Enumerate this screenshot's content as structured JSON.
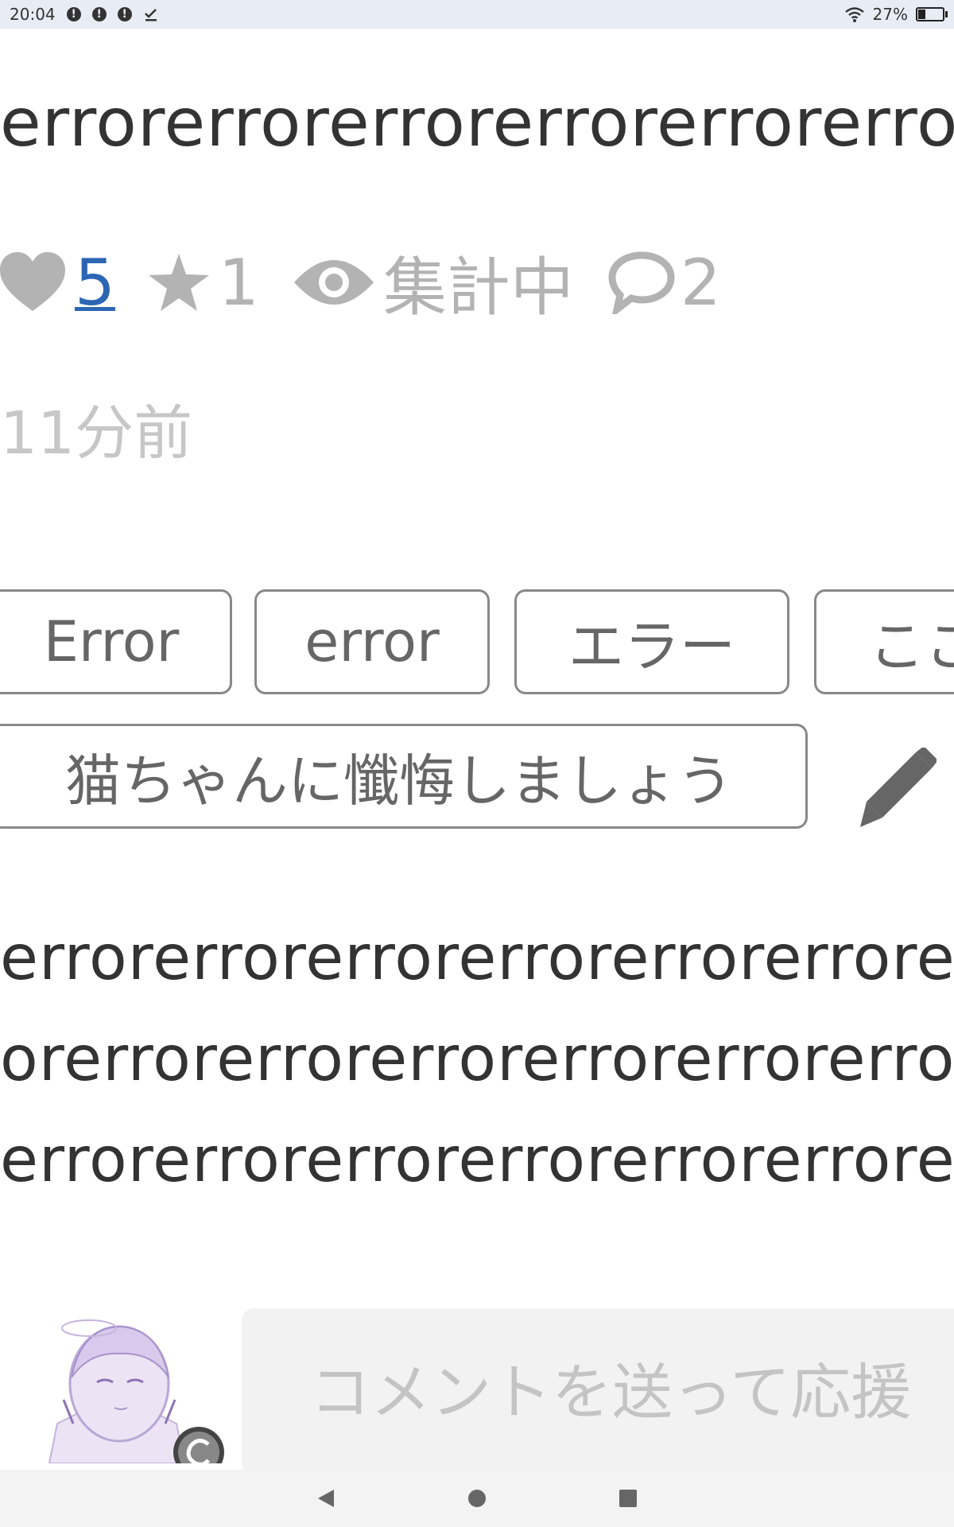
{
  "status_bar": {
    "time": "20:04",
    "notifications": [
      "!",
      "!",
      "!"
    ],
    "battery_text": "27%",
    "battery_level": 0.27
  },
  "post": {
    "title": "errorerrorerrorerrorerrorerror",
    "likes": "5",
    "bookmarks": "1",
    "views": "集計中",
    "comments": "2",
    "timestamp": "11分前",
    "tags": [
      "Error",
      "error",
      "エラー",
      "ここ",
      "猫ちゃんに懺悔しましょう"
    ],
    "body_lines": [
      "errorerrorerrorerrorerrorerrorerror",
      "orerrorerrorerrorerrorerrorerrorerr",
      "errorerrorerrorerrorerrorerrorerror"
    ]
  },
  "comment": {
    "placeholder": "コメントを送って応援"
  },
  "icons": {
    "like": "heart-icon",
    "bookmark": "star-icon",
    "views": "eye-icon",
    "comments": "speech-bubble-icon",
    "edit": "pencil-icon"
  },
  "colors": {
    "link": "#2c66b3",
    "muted": "#b3b3b3",
    "text": "#333333"
  }
}
